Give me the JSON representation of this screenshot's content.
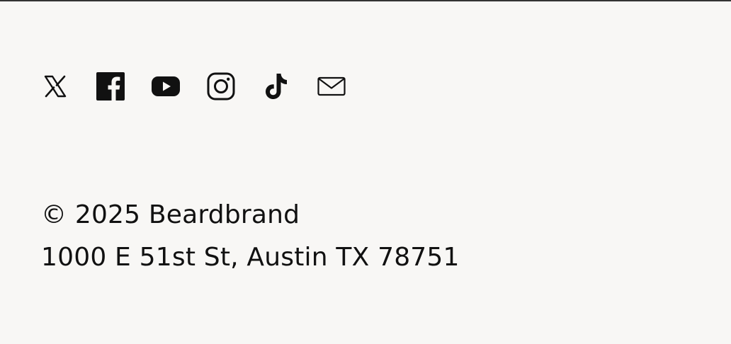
{
  "social": {
    "links": [
      {
        "name": "x-link",
        "icon": "x-icon",
        "label": "X"
      },
      {
        "name": "facebook-link",
        "icon": "facebook-icon",
        "label": "Facebook"
      },
      {
        "name": "youtube-link",
        "icon": "youtube-icon",
        "label": "YouTube"
      },
      {
        "name": "instagram-link",
        "icon": "instagram-icon",
        "label": "Instagram"
      },
      {
        "name": "tiktok-link",
        "icon": "tiktok-icon",
        "label": "TikTok"
      },
      {
        "name": "email-link",
        "icon": "mail-icon",
        "label": "Email"
      }
    ]
  },
  "footer": {
    "copyright": "© 2025 Beardbrand",
    "address": "1000 E 51st St, Austin TX 78751"
  },
  "colors": {
    "background": "#f8f7f5",
    "text": "#111111",
    "rule": "#333333"
  }
}
